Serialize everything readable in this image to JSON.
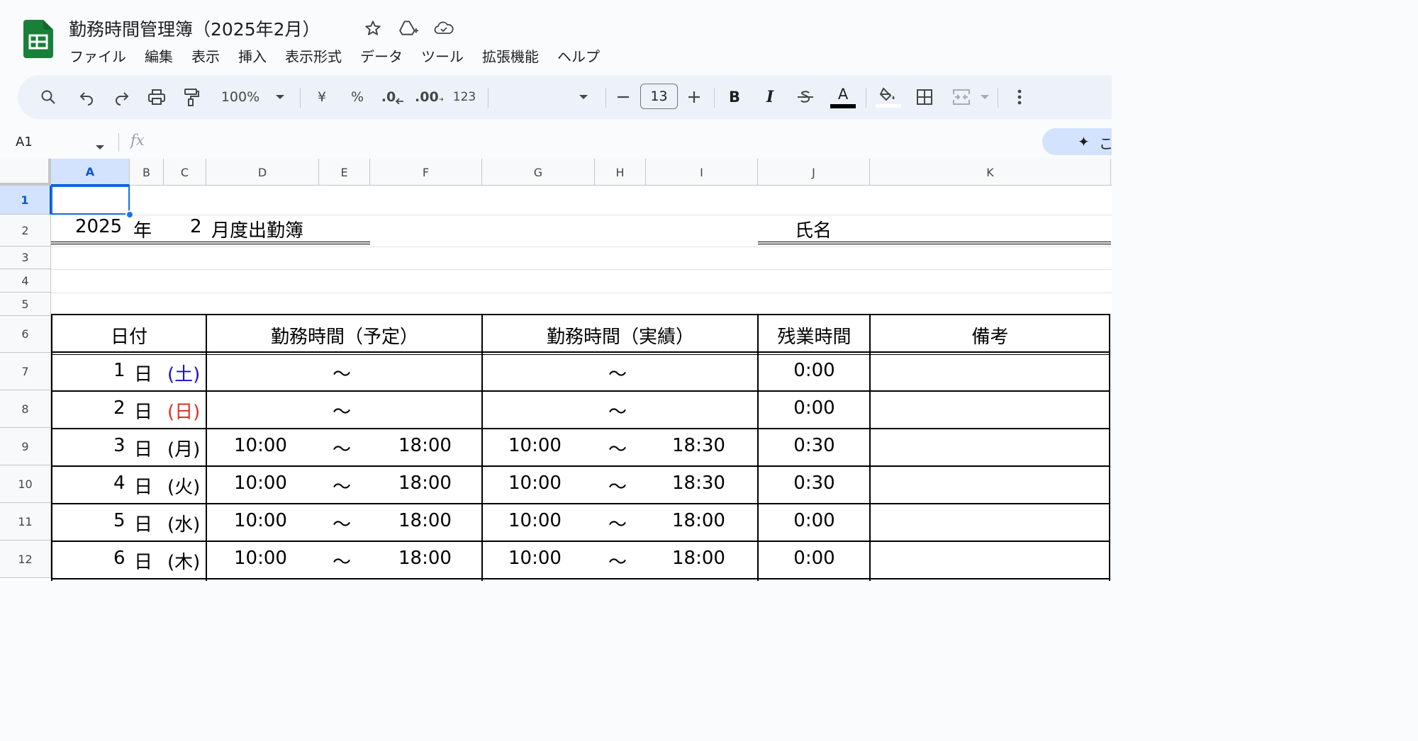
{
  "app": {
    "doc_title": "勤務時間管理簿（2025年2月）",
    "menu": [
      "ファイル",
      "編集",
      "表示",
      "挿入",
      "表示形式",
      "データ",
      "ツール",
      "拡張機能",
      "ヘルプ"
    ]
  },
  "toolbar": {
    "zoom": "100%",
    "currency": "¥",
    "percent": "%",
    "dec_decrease": ".0",
    "dec_increase": ".00",
    "format_123": "123",
    "font_size": "13",
    "bold": "B",
    "italic": "I",
    "text_color_glyph": "A",
    "icons": [
      "search-icon",
      "undo-icon",
      "redo-icon",
      "print-icon",
      "paint-format-icon",
      "zoom-dropdown-icon",
      "font-dropdown-icon",
      "minus-icon",
      "plus-icon",
      "strikethrough-icon",
      "fill-color-icon",
      "borders-icon",
      "merge-cells-icon",
      "more-icon"
    ],
    "text_color_bar": "#000000"
  },
  "formula_bar": {
    "name_box": "A1",
    "fx": "fx",
    "gemini_glyph": "✦",
    "gemini_label": "こ"
  },
  "grid": {
    "columns": [
      "A",
      "B",
      "C",
      "D",
      "E",
      "F",
      "G",
      "H",
      "I",
      "J",
      "K"
    ],
    "selected_column": "A",
    "rows": [
      "1",
      "2",
      "3",
      "4",
      "5",
      "6",
      "7",
      "8",
      "9",
      "10",
      "11",
      "12"
    ],
    "selected_row": "1",
    "selected_cell": "A1"
  },
  "sheet": {
    "year": "2025",
    "year_unit": "年",
    "month": "2",
    "month_label": "月度出勤簿",
    "name_label": "氏名",
    "headers": {
      "date": "日付",
      "planned": "勤務時間（予定）",
      "actual": "勤務時間（実績）",
      "overtime": "残業時間",
      "notes": "備考"
    },
    "day_unit": "日",
    "tilde": "～",
    "rows": [
      {
        "day": "1",
        "weekday": "(土)",
        "weekday_color": "#1a0dcc",
        "p_start": "",
        "p_end": "",
        "a_start": "",
        "a_end": "",
        "overtime": "0:00"
      },
      {
        "day": "2",
        "weekday": "(日)",
        "weekday_color": "#d93025",
        "p_start": "",
        "p_end": "",
        "a_start": "",
        "a_end": "",
        "overtime": "0:00"
      },
      {
        "day": "3",
        "weekday": "(月)",
        "weekday_color": "#000000",
        "p_start": "10:00",
        "p_end": "18:00",
        "a_start": "10:00",
        "a_end": "18:30",
        "overtime": "0:30"
      },
      {
        "day": "4",
        "weekday": "(火)",
        "weekday_color": "#000000",
        "p_start": "10:00",
        "p_end": "18:00",
        "a_start": "10:00",
        "a_end": "18:30",
        "overtime": "0:30"
      },
      {
        "day": "5",
        "weekday": "(水)",
        "weekday_color": "#000000",
        "p_start": "10:00",
        "p_end": "18:00",
        "a_start": "10:00",
        "a_end": "18:00",
        "overtime": "0:00"
      },
      {
        "day": "6",
        "weekday": "(木)",
        "weekday_color": "#000000",
        "p_start": "10:00",
        "p_end": "18:00",
        "a_start": "10:00",
        "a_end": "18:00",
        "overtime": "0:00"
      }
    ]
  }
}
